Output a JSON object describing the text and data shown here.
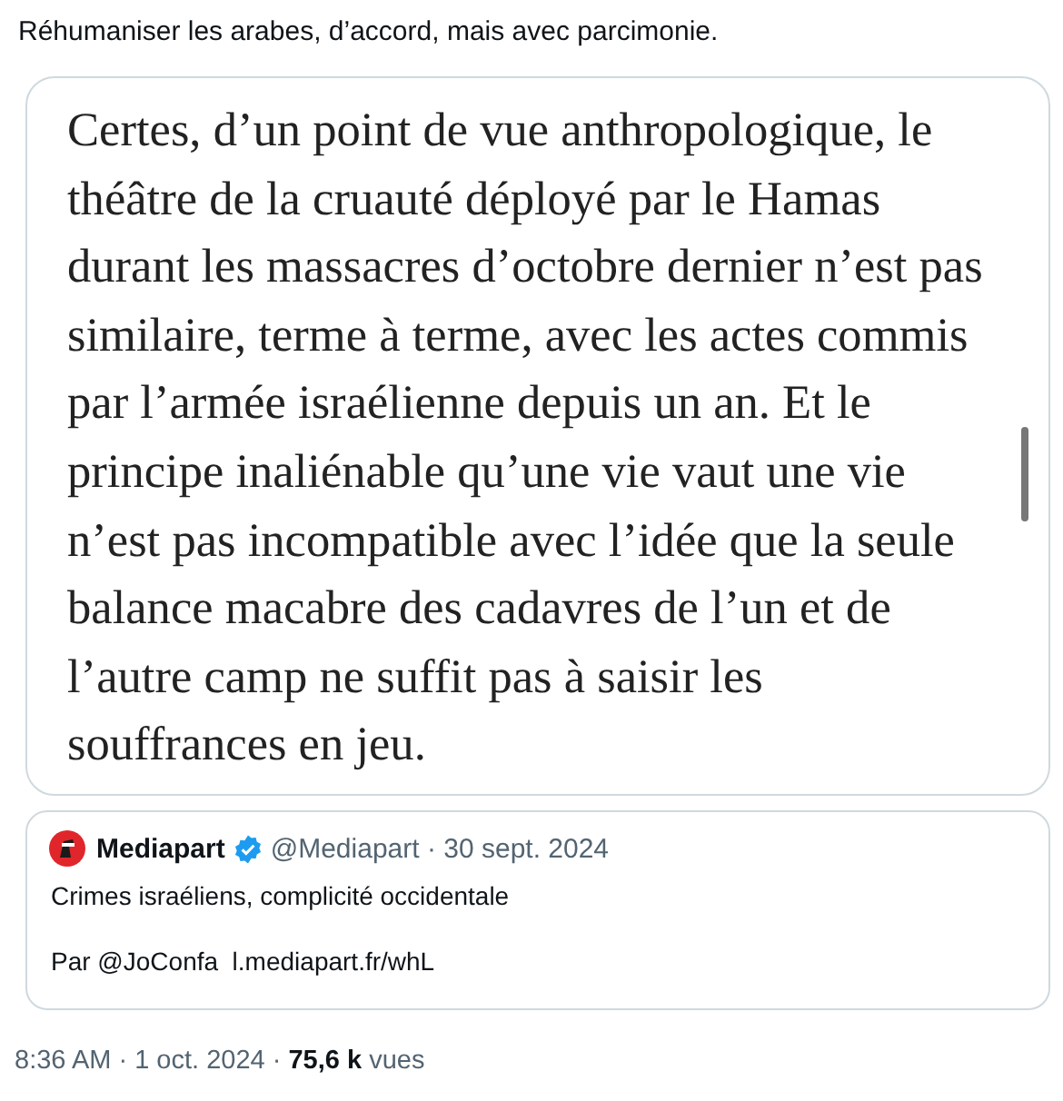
{
  "tweet_text": "Réhumaniser les arabes, d’accord, mais avec parcimonie.",
  "image_text": {
    "lines": [
      "Certes, d’un point de vue anthropologique, le",
      "théâtre de la cruauté déployé par le Hamas",
      "durant les massacres d’octobre dernier n’est pas",
      "similaire, terme à terme, avec les actes commis",
      "par l’armée israélienne depuis un an. Et le",
      "principe inaliénable qu’une vie vaut une vie",
      "n’est pas incompatible avec l’idée que la seule",
      "balance macabre des cadavres de l’un et de",
      "l’autre camp ne suffit pas à saisir les",
      "souffrances en jeu."
    ]
  },
  "quoted_tweet": {
    "name": "Mediapart",
    "verified": true,
    "handle_date": "@Mediapart · 30 sept. 2024",
    "text": "Crimes israéliens, complicité occidentale",
    "byline": "Par @JoConfa  l.mediapart.fr/whL"
  },
  "footer": "8:36 AM · 1 oct. 2024 · **75,6 k** vues"
}
